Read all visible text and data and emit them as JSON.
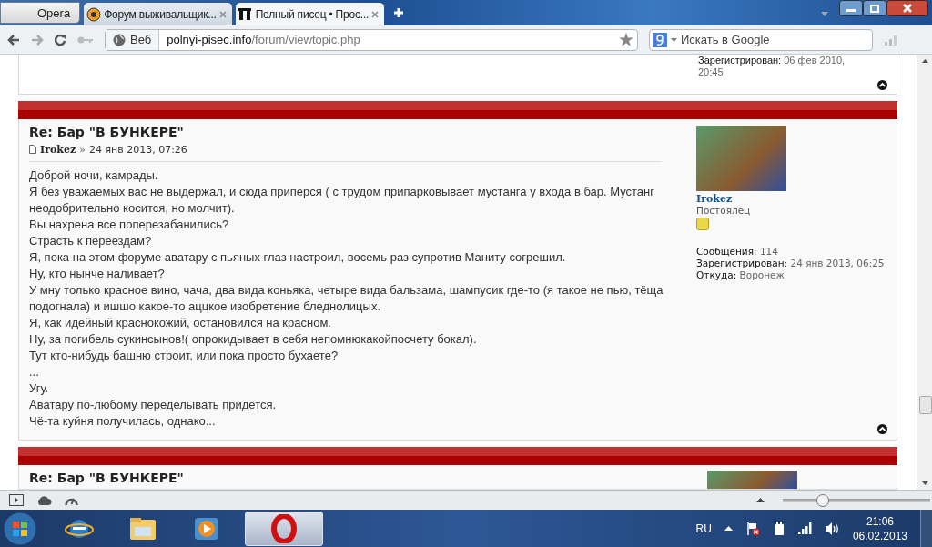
{
  "browser": {
    "menu_label": "Opera",
    "tabs": [
      {
        "title": "Форум выживальщик...",
        "selected": false
      },
      {
        "title": "Полный писец • Прос...",
        "selected": true
      }
    ],
    "address": {
      "mode": "Веб",
      "host": "polnyi-pisec.info",
      "path": "/forum/viewtopic.php"
    },
    "search": {
      "placeholder": "Искать в Google"
    }
  },
  "previous_post": {
    "profile_lines": [
      {
        "label": "Зарегистрирован:",
        "value": "06 фев 2010,"
      },
      {
        "value": "20:45"
      }
    ]
  },
  "post": {
    "title": "Re: Бар \"В БУНКЕРЕ\"",
    "author": "Irokez",
    "separator": "»",
    "date": "24 янв 2013, 07:26",
    "lines": [
      "Доброй ночи, камрады.",
      "Я без уважаемых вас не выдержал, и сюда приперся ( с трудом припарковывает мустанга у входа в бар. Мустанг неодобрительно косится, но молчит).",
      "Вы нахрена все поперезабанились?",
      "Страсть к переездам?",
      "Я, пока на этом форуме аватару с пьяных глаз настроил, восемь раз супротив Маниту согрешил.",
      "Ну, кто нынче наливает?",
      "У мну только красное вино, чача, два вида коньяка, четыре вида бальзама, шампусик где-то (я такое не пью, тёща подогнала) и ишшо какое-то аццкое изобретение бледнолицых.",
      "Я, как идейный краснокожий, остановился на красном.",
      "Ну, за погибель сукинсынов!( опрокидывает в себя непомнюкакойпосчету бокал).",
      "Тут кто-нибудь башню строит, или пока просто бухаете?",
      "...",
      "Угу.",
      "Аватару по-любому переделывать придется.",
      "Чё-та куйня получилась, однако..."
    ],
    "profile": {
      "name": "Irokez",
      "rank": "Постоялец",
      "fields": [
        {
          "label": "Сообщения:",
          "value": "114"
        },
        {
          "label": "Зарегистрирован:",
          "value": "24 янв 2013, 06:25"
        },
        {
          "label": "Откуда:",
          "value": "Воронеж"
        }
      ]
    }
  },
  "next_post": {
    "title": "Re: Бар \"В БУНКЕРЕ\""
  },
  "status_bar": {
    "zoom": {
      "level": 0.27
    }
  },
  "taskbar": {
    "apps": [
      {
        "kind": "ie",
        "selected": false
      },
      {
        "kind": "explorer",
        "selected": false
      },
      {
        "kind": "player",
        "selected": false
      },
      {
        "kind": "opera",
        "selected": true
      }
    ],
    "language": "RU",
    "time": "21:06",
    "date": "06.02.2013"
  }
}
